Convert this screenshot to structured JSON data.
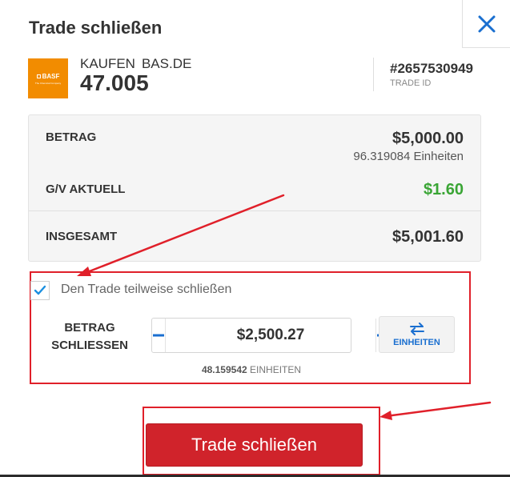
{
  "header": {
    "title": "Trade schließen",
    "close_icon": "close-icon"
  },
  "instrument": {
    "logo_text": "BASF",
    "logo_subtext": "The Chemical Company",
    "action": "KAUFEN",
    "symbol": "BAS.DE",
    "price": "47.005",
    "trade_id": "#2657530949",
    "trade_id_label": "TRADE ID"
  },
  "summary": {
    "amount_label": "BETRAG",
    "amount_value": "$5,000.00",
    "units_text": "96.319084 Einheiten",
    "pl_label": "G/V AKTUELL",
    "pl_value": "$1.60",
    "total_label": "INSGESAMT",
    "total_value": "$5,001.60"
  },
  "partial_close": {
    "checked": true,
    "checkbox_label": "Den Trade teilweise schließen",
    "amount_label_line1": "BETRAG",
    "amount_label_line2": "SCHLIESSEN",
    "amount_value": "$2,500.27",
    "units_button_label": "EINHEITEN",
    "units_count": "48.159542",
    "units_suffix": "EINHEITEN"
  },
  "actions": {
    "close_trade_label": "Trade schließen"
  },
  "colors": {
    "accent_blue": "#1a6fd0",
    "profit_green": "#3aa535",
    "close_red": "#d0232b",
    "annotation_red": "#e0202a",
    "brand_orange": "#f28c00"
  }
}
